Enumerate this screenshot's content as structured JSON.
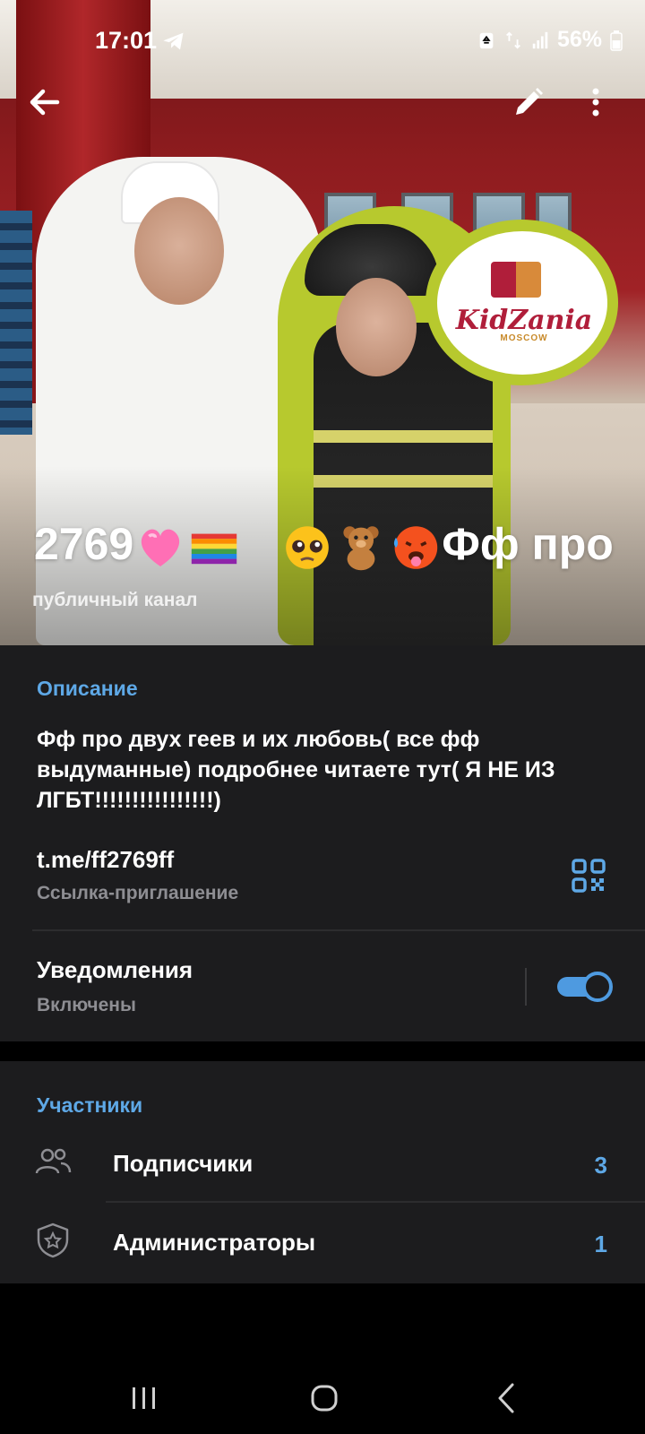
{
  "status_bar": {
    "time": "17:01",
    "battery_percent": "56%",
    "icons": [
      "telegram-icon",
      "recycle-icon",
      "data-arrows-icon",
      "signal-icon",
      "battery-icon"
    ]
  },
  "top_bar": {
    "back_icon": "arrow-left-icon",
    "edit_icon": "pencil-icon",
    "more_icon": "more-vertical-icon"
  },
  "channel": {
    "title": "2769",
    "title_suffix": "Фф про",
    "title_emojis": [
      "pink-heart",
      "rainbow-flag",
      "pleading-face",
      "teddy-bear",
      "hot-face"
    ],
    "subtitle": "публичный канал"
  },
  "info": {
    "description_header": "Описание",
    "description": "Фф про двух геев и их любовь( все фф выдуманные) подробнее читаете тут( Я НЕ ИЗ ЛГБТ!!!!!!!!!!!!!!!!)",
    "link": "t.me/ff2769ff",
    "link_caption": "Ссылка-приглашение",
    "notifications_label": "Уведомления",
    "notifications_status": "Включены",
    "notifications_enabled": true
  },
  "members": {
    "header": "Участники",
    "items": [
      {
        "label": "Подписчики",
        "count": "3",
        "icon": "people-icon"
      },
      {
        "label": "Администраторы",
        "count": "1",
        "icon": "shield-star-icon"
      }
    ]
  },
  "colors": {
    "accent": "#5ea8e6",
    "panel_bg": "#1c1c1e",
    "secondary_text": "#8e8e93"
  }
}
